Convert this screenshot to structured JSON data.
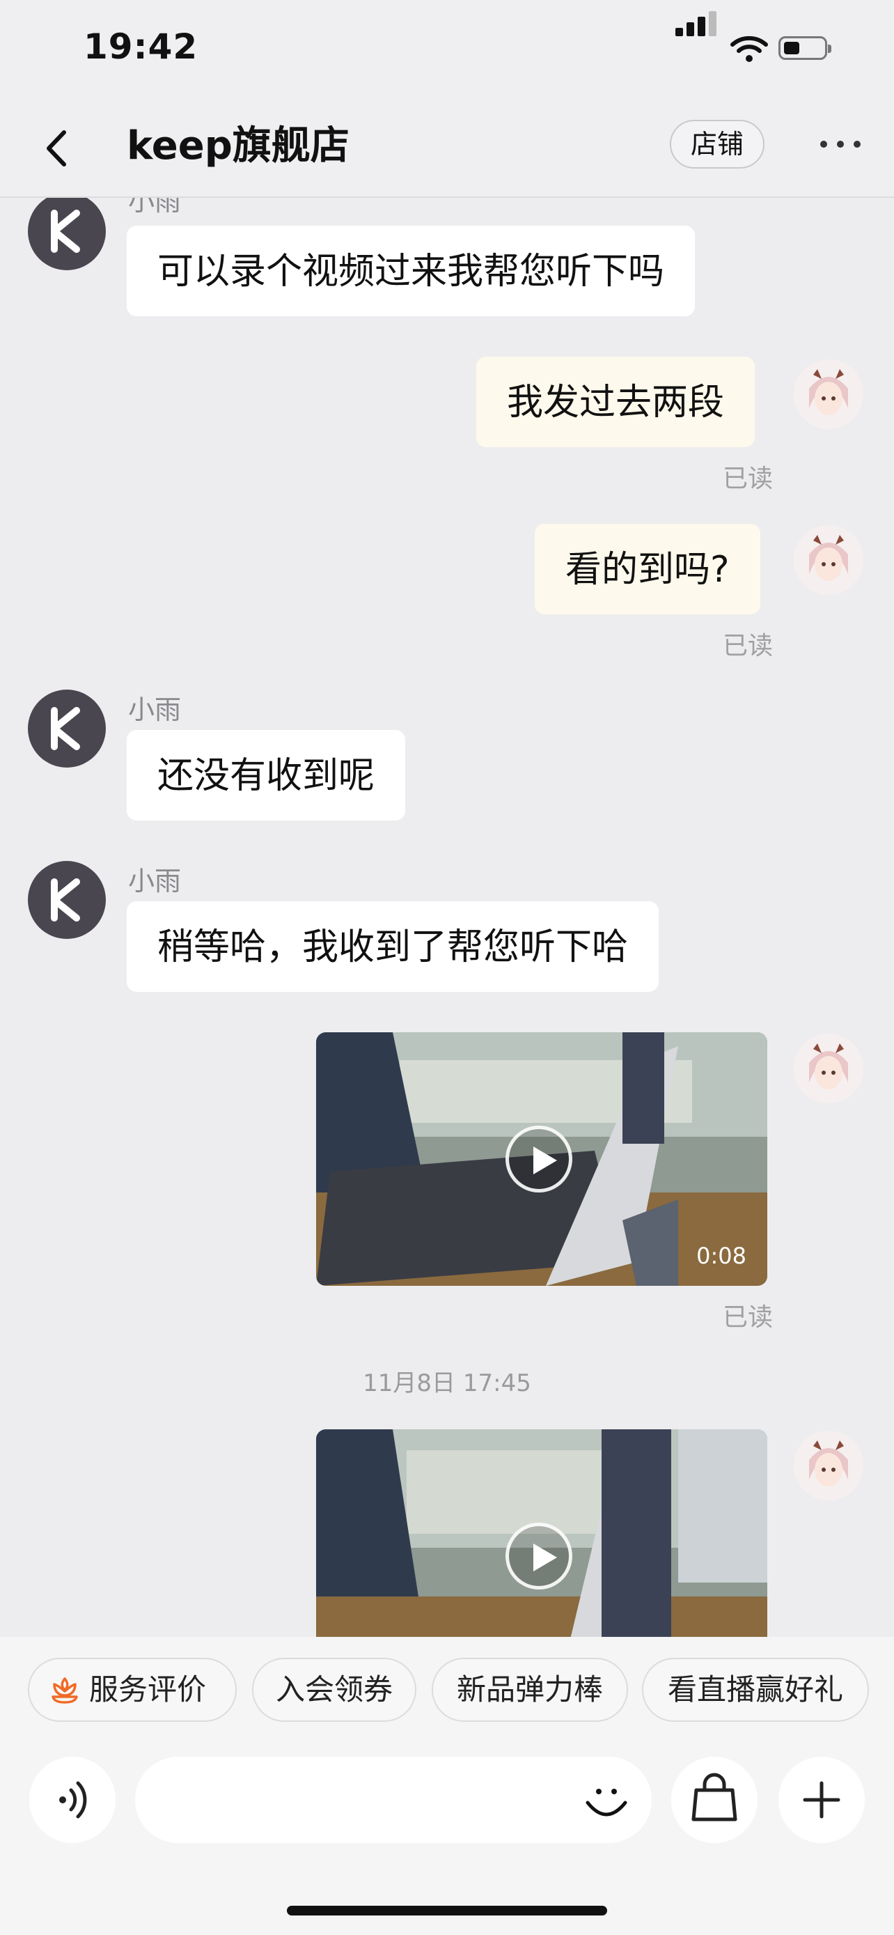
{
  "status_bar": {
    "time": "19:42"
  },
  "header": {
    "title": "keep旗舰店",
    "shop_button": "店铺"
  },
  "messages": [
    {
      "sender": "小雨",
      "text": "可以录个视频过来我帮您听下吗"
    },
    {
      "text": "我发过去两段",
      "status": "已读"
    },
    {
      "text": "看的到吗?",
      "status": "已读"
    },
    {
      "sender": "小雨",
      "text": "还没有收到呢"
    },
    {
      "sender": "小雨",
      "text": "稍等哈，我收到了帮您听下哈"
    },
    {
      "video_duration": "0:08",
      "status": "已读"
    },
    {
      "timestamp": "11月8日 17:45"
    }
  ],
  "quick_replies": [
    "服务评价",
    "入会领券",
    "新品弹力棒",
    "看直播赢好礼"
  ],
  "input": {
    "placeholder": ""
  },
  "colors": {
    "accent_orange": "#F06A26",
    "bubble_out": "#FDF9EC",
    "avatar_k": "#4A4650"
  }
}
